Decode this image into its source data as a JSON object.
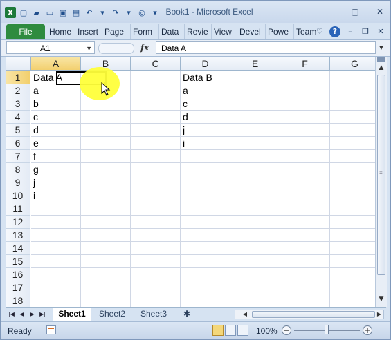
{
  "window": {
    "title": "Book1  -  Microsoft Excel",
    "controls": [
      "minimize",
      "maximize",
      "close"
    ]
  },
  "quick_access": {
    "icons": [
      "excel-app-icon",
      "new-icon",
      "open-icon",
      "folder-icon",
      "image-icon",
      "save-icon",
      "undo-icon",
      "redo-icon",
      "macro-icon",
      "customize-icon"
    ]
  },
  "ribbon": {
    "file_label": "File",
    "tabs": [
      "Home",
      "Insert",
      "Page",
      "Form",
      "Data",
      "Revie",
      "View",
      "Devel",
      "Powe",
      "Team"
    ],
    "right_icons": [
      "minimize-ribbon-icon",
      "help-icon",
      "minimize-window-icon",
      "restore-window-icon",
      "close-window-icon"
    ]
  },
  "formula_bar": {
    "name_box": "A1",
    "fx_label": "fx",
    "content": "Data A"
  },
  "sheet": {
    "columns": [
      "A",
      "B",
      "C",
      "D",
      "E",
      "F",
      "G"
    ],
    "rows": [
      "1",
      "2",
      "3",
      "4",
      "5",
      "6",
      "7",
      "8",
      "9",
      "10",
      "11",
      "12",
      "13",
      "14",
      "15",
      "16",
      "17",
      "18"
    ],
    "active_cell": "A1",
    "column_A": [
      "Data A",
      "a",
      "b",
      "c",
      "d",
      "e",
      "f",
      "g",
      "j",
      "i"
    ],
    "column_D": [
      "Data B",
      "a",
      "c",
      "d",
      "j",
      "i"
    ]
  },
  "sheet_tabs": [
    "Sheet1",
    "Sheet2",
    "Sheet3"
  ],
  "active_sheet": "Sheet1",
  "status": {
    "ready": "Ready",
    "zoom": "100%",
    "zoom_minus": "−",
    "zoom_plus": "+"
  },
  "colors": {
    "file_tab": "#2e8b3f",
    "highlight": "#ffff3a",
    "grid": "#d0d7e5",
    "header_bg": "#e4ebf5"
  }
}
